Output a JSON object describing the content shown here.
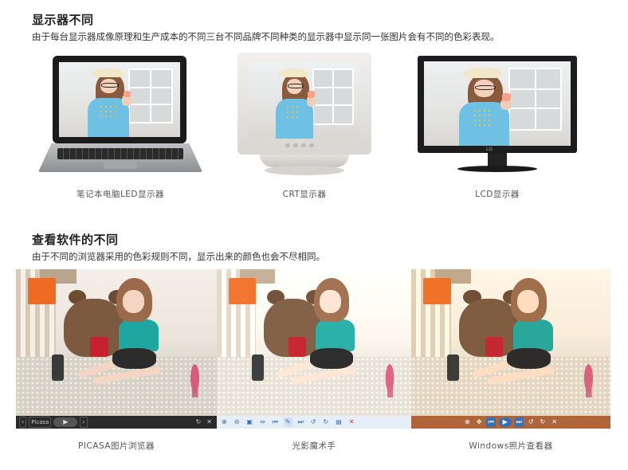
{
  "section1": {
    "title": "显示器不同",
    "desc": "由于每台显示器成像原理和生产成本的不同三台不同品牌不同种类的显示器中显示同一张图片会有不同的色彩表现。",
    "monitors": [
      {
        "caption": "笔记本电脑LED显示器"
      },
      {
        "caption": "CRT显示器"
      },
      {
        "caption": "LCD显示器",
        "brand": "LG"
      }
    ]
  },
  "section2": {
    "title": "查看软件的不同",
    "desc": "由于不同的浏览器采用的色彩规则不同，显示出来的颜色也会不尽相同。",
    "viewers": [
      {
        "caption": "PICASA图片浏览器",
        "toolbar_text": "Picasa"
      },
      {
        "caption": "光影魔术手"
      },
      {
        "caption": "Windows照片查看器"
      }
    ]
  },
  "colors": {
    "picasa_bar": "#2a2a2a",
    "nm_bar": "#e6eef7",
    "win_bar": "#b0643a",
    "accent_blue": "#2f6fb8"
  },
  "icons": [
    "play-icon",
    "prev-icon",
    "next-icon",
    "zoom-icon",
    "rotate-icon",
    "delete-icon"
  ]
}
